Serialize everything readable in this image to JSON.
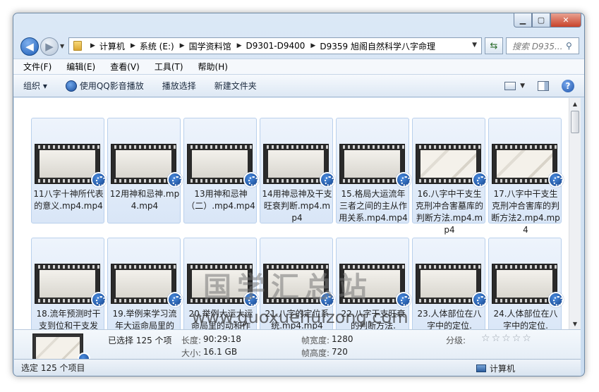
{
  "breadcrumbs": [
    "计算机",
    "系统 (E:)",
    "国学资料馆",
    "D9301-D9400",
    "D9359 旭阁自然科学八字命理"
  ],
  "search": {
    "placeholder": "搜索 D935..."
  },
  "menu": [
    "文件(F)",
    "编辑(E)",
    "查看(V)",
    "工具(T)",
    "帮助(H)"
  ],
  "toolbar": {
    "organize": "组织 ▾",
    "play_qq": "使用QQ影音播放",
    "play_selected": "播放选择",
    "new_folder": "新建文件夹"
  },
  "files": [
    {
      "label": "11八字十神所代表的意义.mp4.mp4"
    },
    {
      "label": "12用神和忌神.mp4.mp4"
    },
    {
      "label": "13用神和忌神（二）.mp4.mp4"
    },
    {
      "label": "14用神忌神及干支旺衰判断.mp4.mp4"
    },
    {
      "label": "15.格局大运流年三者之间的主从作用关系.mp4.mp4"
    },
    {
      "label": "16.八字中干支生克刑冲合害墓库的判断方法.mp4.mp4"
    },
    {
      "label": "17.八字中干支生克刑冲合害库的判断方法2.mp4.mp4"
    },
    {
      "label": "18.流年预测时干支到位和干支发"
    },
    {
      "label": "19.举例来学习流年大运命局里的"
    },
    {
      "label": "20.举例大运大运命局里的动和作"
    },
    {
      "label": "21.八字的定位系统.mp4.mp4"
    },
    {
      "label": "22.八字干支旺衰的判断方法."
    },
    {
      "label": "23.人体部位在八字中的定位."
    },
    {
      "label": "24.人体部位在八字中的定位."
    }
  ],
  "watermark": {
    "cn": "国学汇总站",
    "url": "www.guoxuehuizong.com"
  },
  "details": {
    "selected": "已选择 125 个项",
    "length_key": "长度:",
    "length_val": "90:29:18",
    "size_key": "大小:",
    "size_val": "16.1 GB",
    "width_key": "帧宽度:",
    "width_val": "1280",
    "height_key": "帧高度:",
    "height_val": "720",
    "rating_key": "分级:",
    "rating": 0
  },
  "status": {
    "left": "选定 125 个项目",
    "right": "计算机"
  }
}
